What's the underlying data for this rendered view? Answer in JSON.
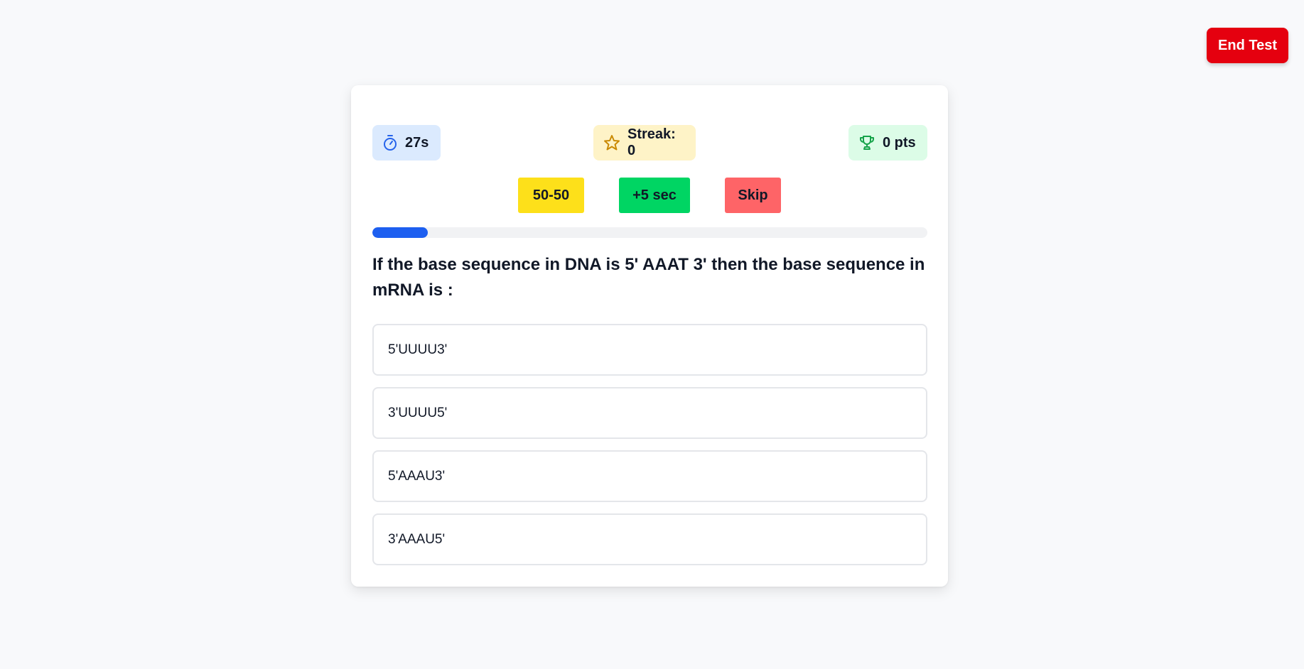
{
  "header": {
    "end_test_label": "End Test"
  },
  "stats": {
    "timer": {
      "icon": "stopwatch-icon",
      "text": "27s",
      "color": "#2563eb"
    },
    "streak": {
      "icon": "star-icon",
      "text": "Streak: 0",
      "color": "#ca8a04"
    },
    "points": {
      "icon": "trophy-icon",
      "text": "0 pts",
      "color": "#16a34a"
    }
  },
  "lifelines": {
    "fifty_fifty": "50-50",
    "extra_time": "+5 sec",
    "skip": "Skip"
  },
  "progress": {
    "fraction": 0.1
  },
  "question": {
    "text": "If the base sequence in DNA is 5' AAAT 3' then the base sequence in mRNA is :",
    "options": [
      "5'UUUU3'",
      "3'UUUU5'",
      "5'AAAU3'",
      "3'AAAU5'"
    ]
  },
  "colors": {
    "end_test": "#e5000f",
    "fifty_fifty": "#fde01a",
    "extra_time": "#00d563",
    "skip": "#fe6467",
    "progress": "#1d5ff0"
  }
}
